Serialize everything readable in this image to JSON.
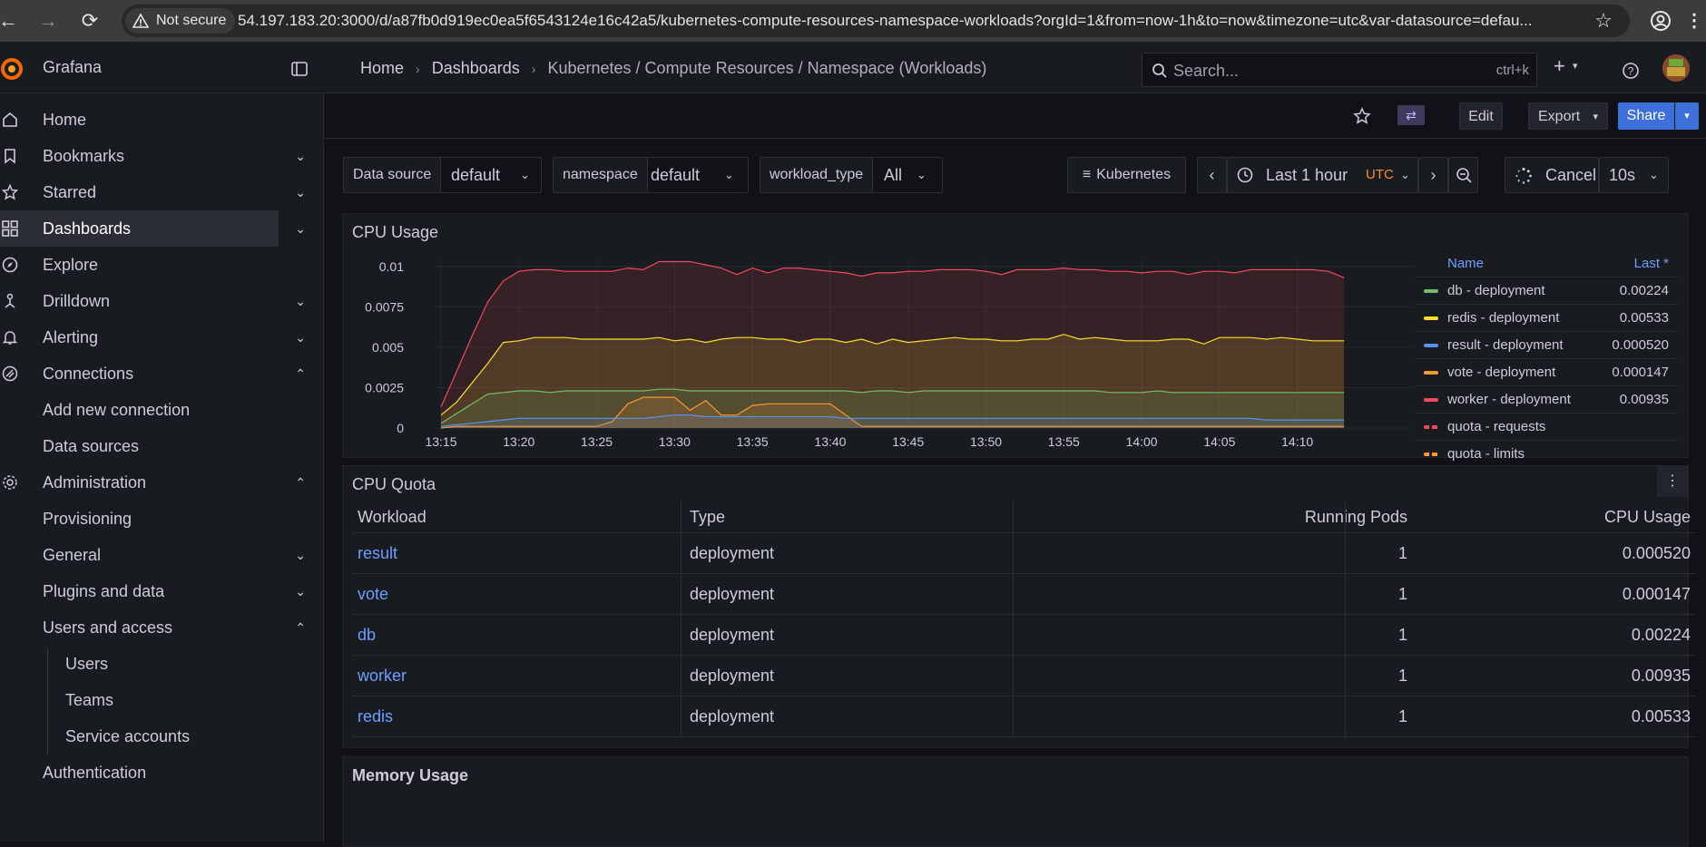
{
  "browser": {
    "not_secure": "Not secure",
    "url": "54.197.183.20:3000/d/a87fb0d919ec0ea5f6543124e16c42a5/kubernetes-compute-resources-namespace-workloads?orgId=1&from=now-1h&to=now&timezone=utc&var-datasource=defau..."
  },
  "topbar": {
    "app": "Grafana",
    "breadcrumb": [
      "Home",
      "Dashboards",
      "Kubernetes / Compute Resources / Namespace (Workloads)"
    ],
    "search_placeholder": "Search...",
    "search_shortcut": "ctrl+k"
  },
  "sidebar": {
    "items": [
      {
        "label": "Home",
        "icon": "home-icon"
      },
      {
        "label": "Bookmarks",
        "icon": "bookmark-icon"
      },
      {
        "label": "Starred",
        "icon": "star-icon"
      },
      {
        "label": "Dashboards",
        "icon": "apps-icon"
      },
      {
        "label": "Explore",
        "icon": "compass-icon"
      },
      {
        "label": "Drilldown",
        "icon": "drilldown-icon"
      },
      {
        "label": "Alerting",
        "icon": "bell-icon"
      },
      {
        "label": "Connections",
        "icon": "connections-icon"
      },
      {
        "label": "Add new connection"
      },
      {
        "label": "Data sources"
      },
      {
        "label": "Administration",
        "icon": "cog-icon"
      },
      {
        "label": "Provisioning"
      },
      {
        "label": "General"
      },
      {
        "label": "Plugins and data"
      },
      {
        "label": "Users and access"
      },
      {
        "label": "Users"
      },
      {
        "label": "Teams"
      },
      {
        "label": "Service accounts"
      },
      {
        "label": "Authentication"
      }
    ]
  },
  "actions": {
    "edit": "Edit",
    "export": "Export",
    "share": "Share"
  },
  "variables": {
    "datasource": {
      "label": "Data source",
      "value": "default"
    },
    "namespace": {
      "label": "namespace",
      "value": "default"
    },
    "workload_type": {
      "label": "workload_type",
      "value": "All"
    }
  },
  "timebar": {
    "kubernetes": "Kubernetes",
    "range": "Last 1 hour",
    "tz": "UTC",
    "cancel": "Cancel",
    "refresh": "10s"
  },
  "cpu_usage": {
    "title": "CPU Usage",
    "legend_name": "Name",
    "legend_last": "Last *",
    "legend": [
      {
        "name": "db - deployment",
        "value": "0.00224",
        "color": "#73bf69"
      },
      {
        "name": "redis - deployment",
        "value": "0.00533",
        "color": "#fade2a"
      },
      {
        "name": "result - deployment",
        "value": "0.000520",
        "color": "#5794f2"
      },
      {
        "name": "vote - deployment",
        "value": "0.000147",
        "color": "#ff9830"
      },
      {
        "name": "worker - deployment",
        "value": "0.00935",
        "color": "#f2495c"
      },
      {
        "name": "quota - requests",
        "value": "",
        "color": "#f2495c"
      },
      {
        "name": "quota - limits",
        "value": "",
        "color": "#ff9830"
      }
    ]
  },
  "chart_data": {
    "type": "area",
    "title": "CPU Usage",
    "x": [
      "13:15",
      "13:16",
      "13:17",
      "13:18",
      "13:19",
      "13:20",
      "13:21",
      "13:22",
      "13:23",
      "13:24",
      "13:25",
      "13:26",
      "13:27",
      "13:28",
      "13:29",
      "13:30",
      "13:31",
      "13:32",
      "13:33",
      "13:34",
      "13:35",
      "13:36",
      "13:37",
      "13:38",
      "13:39",
      "13:40",
      "13:41",
      "13:42",
      "13:43",
      "13:44",
      "13:45",
      "13:46",
      "13:47",
      "13:48",
      "13:49",
      "13:50",
      "13:51",
      "13:52",
      "13:53",
      "13:54",
      "13:55",
      "13:56",
      "13:57",
      "13:58",
      "13:59",
      "14:00",
      "14:01",
      "14:02",
      "14:03",
      "14:04",
      "14:05",
      "14:06",
      "14:07",
      "14:08",
      "14:09",
      "14:10",
      "14:11",
      "14:12",
      "14:13"
    ],
    "xticks": [
      "13:15",
      "13:20",
      "13:25",
      "13:30",
      "13:35",
      "13:40",
      "13:45",
      "13:50",
      "13:55",
      "14:00",
      "14:05",
      "14:10"
    ],
    "yticks": [
      "0",
      "0.0025",
      "0.005",
      "0.0075",
      "0.01"
    ],
    "ylim": [
      0,
      0.011
    ],
    "series": [
      {
        "name": "worker - deployment",
        "color": "#f2495c",
        "values": [
          0.0013,
          0.0035,
          0.0057,
          0.0078,
          0.0091,
          0.0097,
          0.0098,
          0.0098,
          0.0097,
          0.0097,
          0.0097,
          0.0097,
          0.0099,
          0.0098,
          0.0103,
          0.0103,
          0.0103,
          0.0101,
          0.0099,
          0.0095,
          0.0099,
          0.0096,
          0.0099,
          0.0099,
          0.0098,
          0.0097,
          0.0096,
          0.0094,
          0.0096,
          0.0096,
          0.0097,
          0.0097,
          0.0098,
          0.0098,
          0.0098,
          0.0097,
          0.0095,
          0.0098,
          0.0098,
          0.0098,
          0.0099,
          0.0098,
          0.0098,
          0.0097,
          0.0097,
          0.0096,
          0.0097,
          0.0097,
          0.0095,
          0.0097,
          0.0097,
          0.0096,
          0.0098,
          0.0098,
          0.0098,
          0.0098,
          0.0098,
          0.0097,
          0.0093
        ]
      },
      {
        "name": "redis - deployment",
        "color": "#fade2a",
        "values": [
          0.0008,
          0.0016,
          0.0028,
          0.004,
          0.0053,
          0.0054,
          0.0056,
          0.0056,
          0.0056,
          0.0055,
          0.0055,
          0.0055,
          0.0055,
          0.0055,
          0.0056,
          0.0054,
          0.0055,
          0.0053,
          0.0055,
          0.0056,
          0.0056,
          0.0055,
          0.0055,
          0.0053,
          0.0055,
          0.0055,
          0.0053,
          0.0055,
          0.0052,
          0.0055,
          0.0053,
          0.0054,
          0.0055,
          0.0056,
          0.0055,
          0.0055,
          0.0054,
          0.0054,
          0.0055,
          0.0055,
          0.0058,
          0.0055,
          0.0056,
          0.0055,
          0.0054,
          0.0054,
          0.0054,
          0.0055,
          0.0055,
          0.0052,
          0.0056,
          0.0056,
          0.0056,
          0.0055,
          0.0056,
          0.0055,
          0.0054,
          0.0054,
          0.0054
        ]
      },
      {
        "name": "db - deployment",
        "color": "#73bf69",
        "values": [
          0.0003,
          0.0009,
          0.0015,
          0.0021,
          0.0022,
          0.0023,
          0.0023,
          0.0022,
          0.0023,
          0.0023,
          0.0023,
          0.0023,
          0.0023,
          0.0023,
          0.0024,
          0.0024,
          0.0023,
          0.0023,
          0.0023,
          0.0023,
          0.0023,
          0.0023,
          0.0023,
          0.0023,
          0.0023,
          0.0023,
          0.0023,
          0.0022,
          0.0023,
          0.0023,
          0.0022,
          0.0023,
          0.0023,
          0.0023,
          0.0023,
          0.0023,
          0.0023,
          0.0023,
          0.0023,
          0.0023,
          0.0023,
          0.0023,
          0.0023,
          0.0022,
          0.0022,
          0.0022,
          0.0023,
          0.0022,
          0.0022,
          0.0022,
          0.0022,
          0.0022,
          0.0022,
          0.0022,
          0.0022,
          0.0022,
          0.0022,
          0.0022,
          0.0022
        ]
      },
      {
        "name": "vote - deployment",
        "color": "#ff9830",
        "values": [
          0.0,
          0.0001,
          0.0001,
          0.0001,
          0.0001,
          0.0001,
          0.0001,
          0.0001,
          0.0001,
          0.0001,
          0.0001,
          0.0004,
          0.0015,
          0.0019,
          0.0019,
          0.0019,
          0.0011,
          0.0017,
          0.0008,
          0.0008,
          0.0014,
          0.0015,
          0.0015,
          0.0015,
          0.0015,
          0.0015,
          0.0008,
          0.0001,
          0.0001,
          0.0001,
          0.0001,
          0.0001,
          0.0001,
          0.0001,
          0.0001,
          0.0001,
          0.0001,
          0.0001,
          0.0001,
          0.0001,
          0.0001,
          0.0001,
          0.0001,
          0.0001,
          0.0001,
          0.0001,
          0.0001,
          0.0001,
          0.0001,
          0.0001,
          0.0001,
          0.0001,
          0.0001,
          0.0001,
          0.0001,
          0.0001,
          0.0001,
          0.0001,
          0.0001
        ]
      },
      {
        "name": "result - deployment",
        "color": "#5794f2",
        "values": [
          0.0001,
          0.0002,
          0.0003,
          0.0004,
          0.0005,
          0.0006,
          0.0006,
          0.0006,
          0.0006,
          0.0006,
          0.0006,
          0.0006,
          0.0006,
          0.0006,
          0.0007,
          0.0008,
          0.0008,
          0.0007,
          0.0007,
          0.0007,
          0.0007,
          0.0007,
          0.0007,
          0.0007,
          0.0007,
          0.0007,
          0.0006,
          0.0006,
          0.0006,
          0.0006,
          0.0006,
          0.0006,
          0.0006,
          0.0006,
          0.0006,
          0.0006,
          0.0006,
          0.0006,
          0.0006,
          0.0006,
          0.0006,
          0.0006,
          0.0006,
          0.0006,
          0.0006,
          0.0006,
          0.0006,
          0.0006,
          0.0006,
          0.0006,
          0.0006,
          0.0006,
          0.0006,
          0.0005,
          0.0005,
          0.0005,
          0.0005,
          0.0005,
          0.0005
        ]
      }
    ]
  },
  "cpu_quota": {
    "title": "CPU Quota",
    "columns": [
      "Workload",
      "Type",
      "Running Pods",
      "CPU Usage"
    ],
    "rows": [
      [
        "result",
        "deployment",
        "1",
        "0.000520"
      ],
      [
        "vote",
        "deployment",
        "1",
        "0.000147"
      ],
      [
        "db",
        "deployment",
        "1",
        "0.00224"
      ],
      [
        "worker",
        "deployment",
        "1",
        "0.00935"
      ],
      [
        "redis",
        "deployment",
        "1",
        "0.00533"
      ]
    ]
  },
  "memory_usage": {
    "title": "Memory Usage"
  }
}
